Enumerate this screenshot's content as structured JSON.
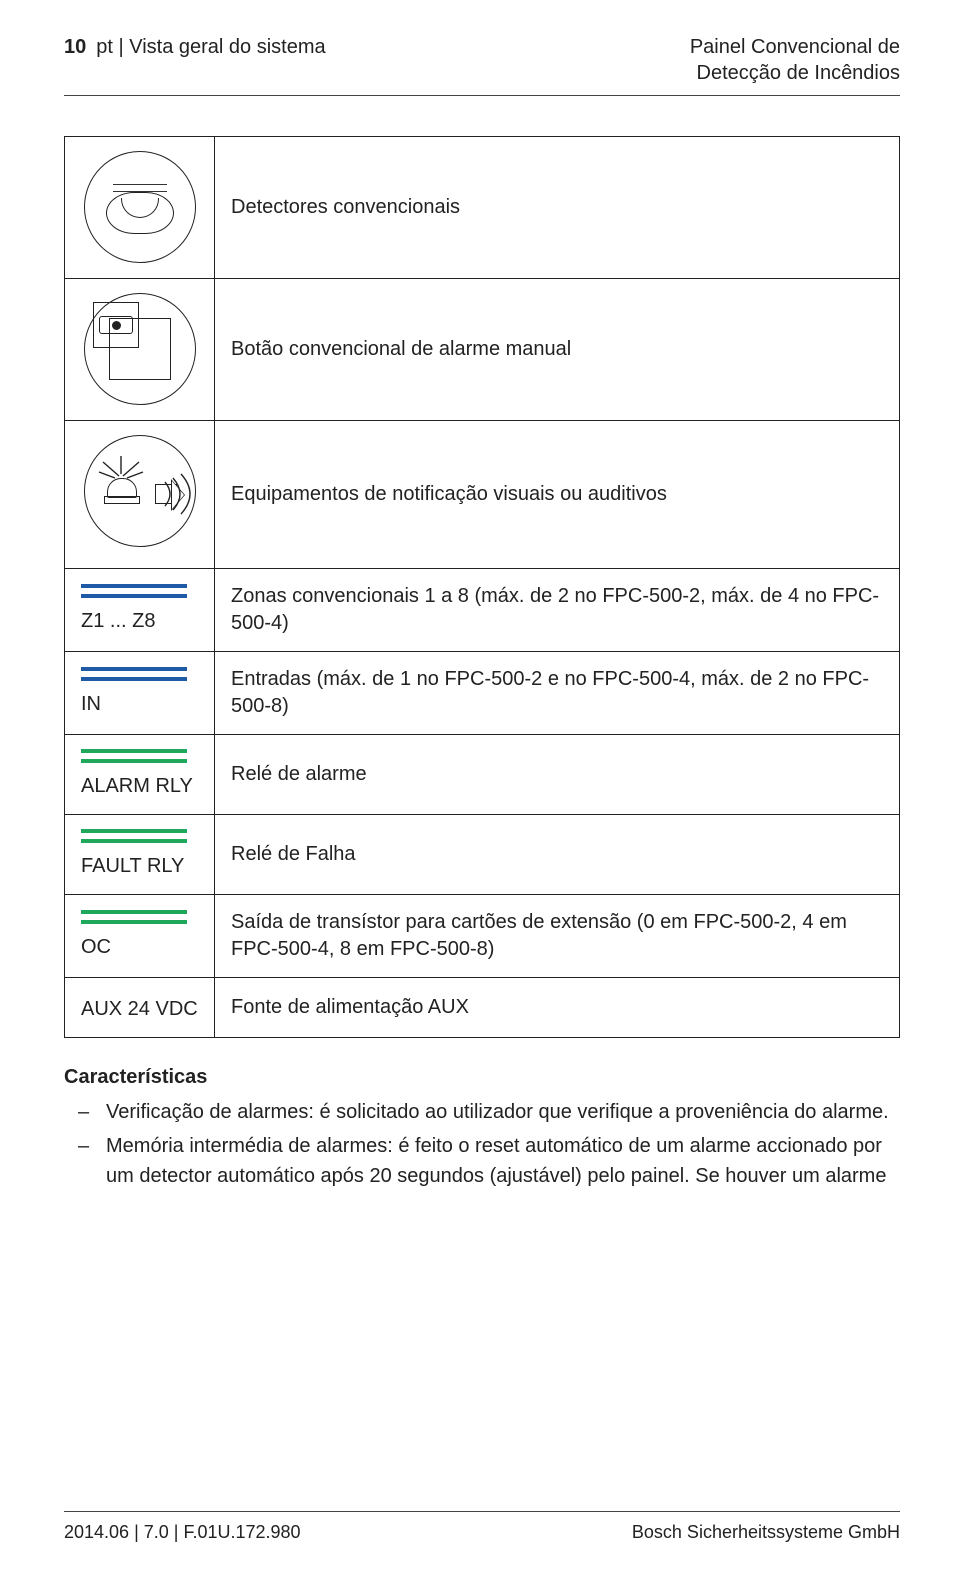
{
  "header": {
    "page_number": "10",
    "breadcrumb": "pt | Vista geral do sistema",
    "title_line1": "Painel Convencional de",
    "title_line2": "Detecção de Incêndios"
  },
  "rows": {
    "row1_desc": "Detectores convencionais",
    "row2_desc": "Botão convencional de alarme manual",
    "row3_desc": "Equipamentos de notificação visuais ou auditivos",
    "row4_label": "Z1 ... Z8",
    "row4_desc": "Zonas convencionais 1 a 8 (máx. de 2 no FPC-500-2, máx. de 4 no FPC-500-4)",
    "row5_label": "IN",
    "row5_desc": "Entradas (máx. de 1 no FPC-500-2 e no FPC-500-4, máx. de 2 no FPC-500-8)",
    "row6_label": "ALARM RLY",
    "row6_desc": "Relé de alarme",
    "row7_label": "FAULT RLY",
    "row7_desc": "Relé de Falha",
    "row8_label": "OC",
    "row8_desc": "Saída de transístor para cartões de extensão (0 em FPC-500-2, 4 em FPC-500-4, 8 em FPC-500-8)",
    "row9_label": "AUX 24 VDC",
    "row9_desc": "Fonte de alimentação AUX"
  },
  "features": {
    "title": "Características",
    "item1": "Verificação de alarmes: é solicitado ao utilizador que verifique a proveniência do alarme.",
    "item2": "Memória intermédia de alarmes: é feito o reset automático de um alarme accionado por um detector automático após 20 segundos (ajustável) pelo painel. Se houver um alarme"
  },
  "footer": {
    "left": "2014.06 | 7.0 | F.01U.172.980",
    "right": "Bosch Sicherheitssysteme GmbH"
  }
}
